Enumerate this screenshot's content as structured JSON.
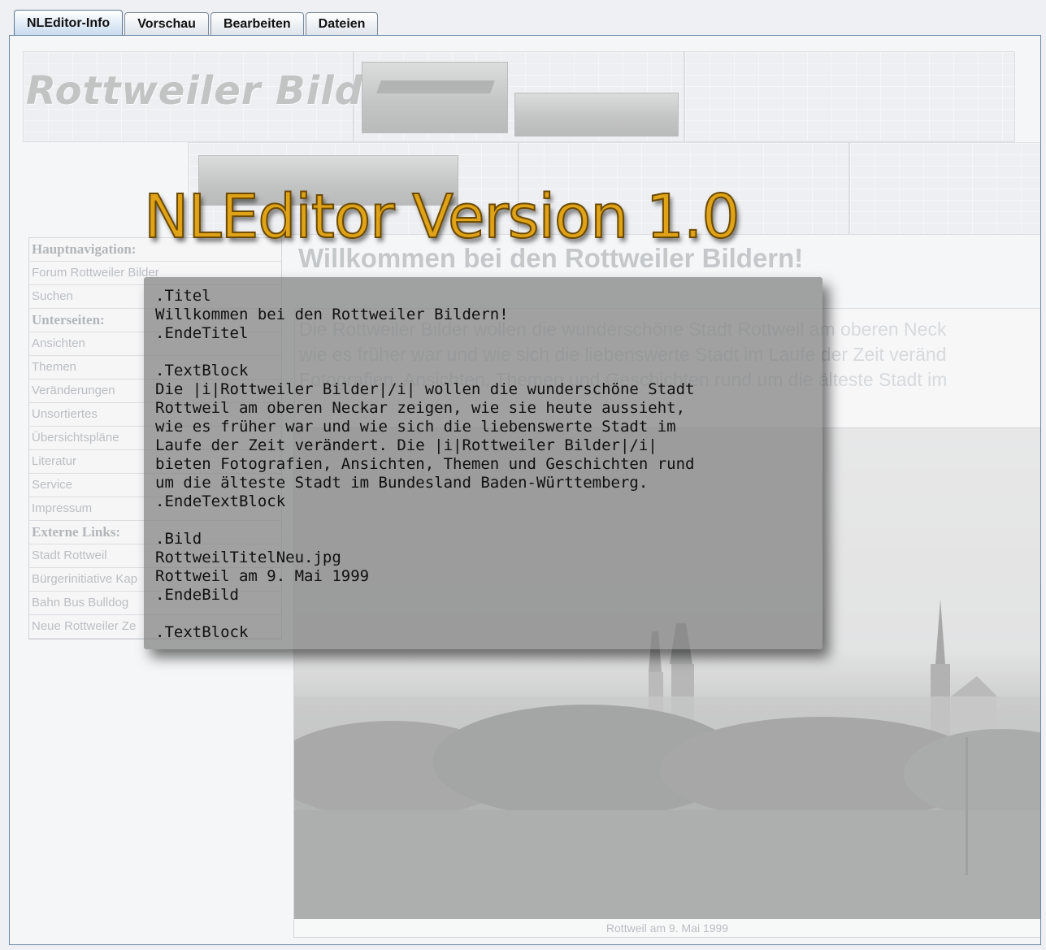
{
  "tabs": [
    "NLEditor-Info",
    "Vorschau",
    "Bearbeiten",
    "Dateien"
  ],
  "banner": {
    "title": "Rottweiler Bilder"
  },
  "overlay_title": "NLEditor Version 1.0",
  "nav": [
    {
      "label": "Hauptnavigation:",
      "head": true
    },
    {
      "label": "Forum Rottweiler Bilder"
    },
    {
      "label": "Suchen"
    },
    {
      "label": "Unterseiten:",
      "head": true
    },
    {
      "label": "Ansichten"
    },
    {
      "label": "Themen"
    },
    {
      "label": "Veränderungen"
    },
    {
      "label": "Unsortiertes"
    },
    {
      "label": "Übersichtspläne"
    },
    {
      "label": "Literatur"
    },
    {
      "label": "Service"
    },
    {
      "label": "Impressum"
    },
    {
      "label": "Externe Links:",
      "head": true
    },
    {
      "label": "Stadt Rottweil"
    },
    {
      "label": "Bürgerinitiative Kap"
    },
    {
      "label": "Bahn Bus Bulldog"
    },
    {
      "label": "Neue Rottweiler Ze"
    }
  ],
  "welcome": "Willkommen bei den Rottweiler Bildern!",
  "bg_text_lines": [
    "Die Rottweiler Bilder wollen die wunderschöne Stadt Rottweil am oberen Neck",
    "wie es früher war und wie sich die liebenswerte Stadt im Laufe der Zeit veränd",
    "Fotografien, Ansichten, Themen und Geschichten rund um die älteste Stadt im"
  ],
  "photo_caption": "Rottweil am 9. Mai 1999",
  "code_lines": [
    ".Titel",
    "Willkommen bei den Rottweiler Bildern!",
    ".EndeTitel",
    "",
    ".TextBlock",
    "Die |i|Rottweiler Bilder|/i| wollen die wunderschöne Stadt",
    "Rottweil am oberen Neckar zeigen, wie sie heute aussieht,",
    "wie es früher war und wie sich die liebenswerte Stadt im",
    "Laufe der Zeit verändert. Die |i|Rottweiler Bilder|/i|",
    "bieten Fotografien, Ansichten, Themen und Geschichten rund",
    "um die älteste Stadt im Bundesland Baden-Württemberg.",
    ".EndeTextBlock",
    "",
    ".Bild",
    "RottweilTitelNeu.jpg",
    "Rottweil am 9. Mai 1999",
    ".EndeBild",
    "",
    ".TextBlock"
  ]
}
